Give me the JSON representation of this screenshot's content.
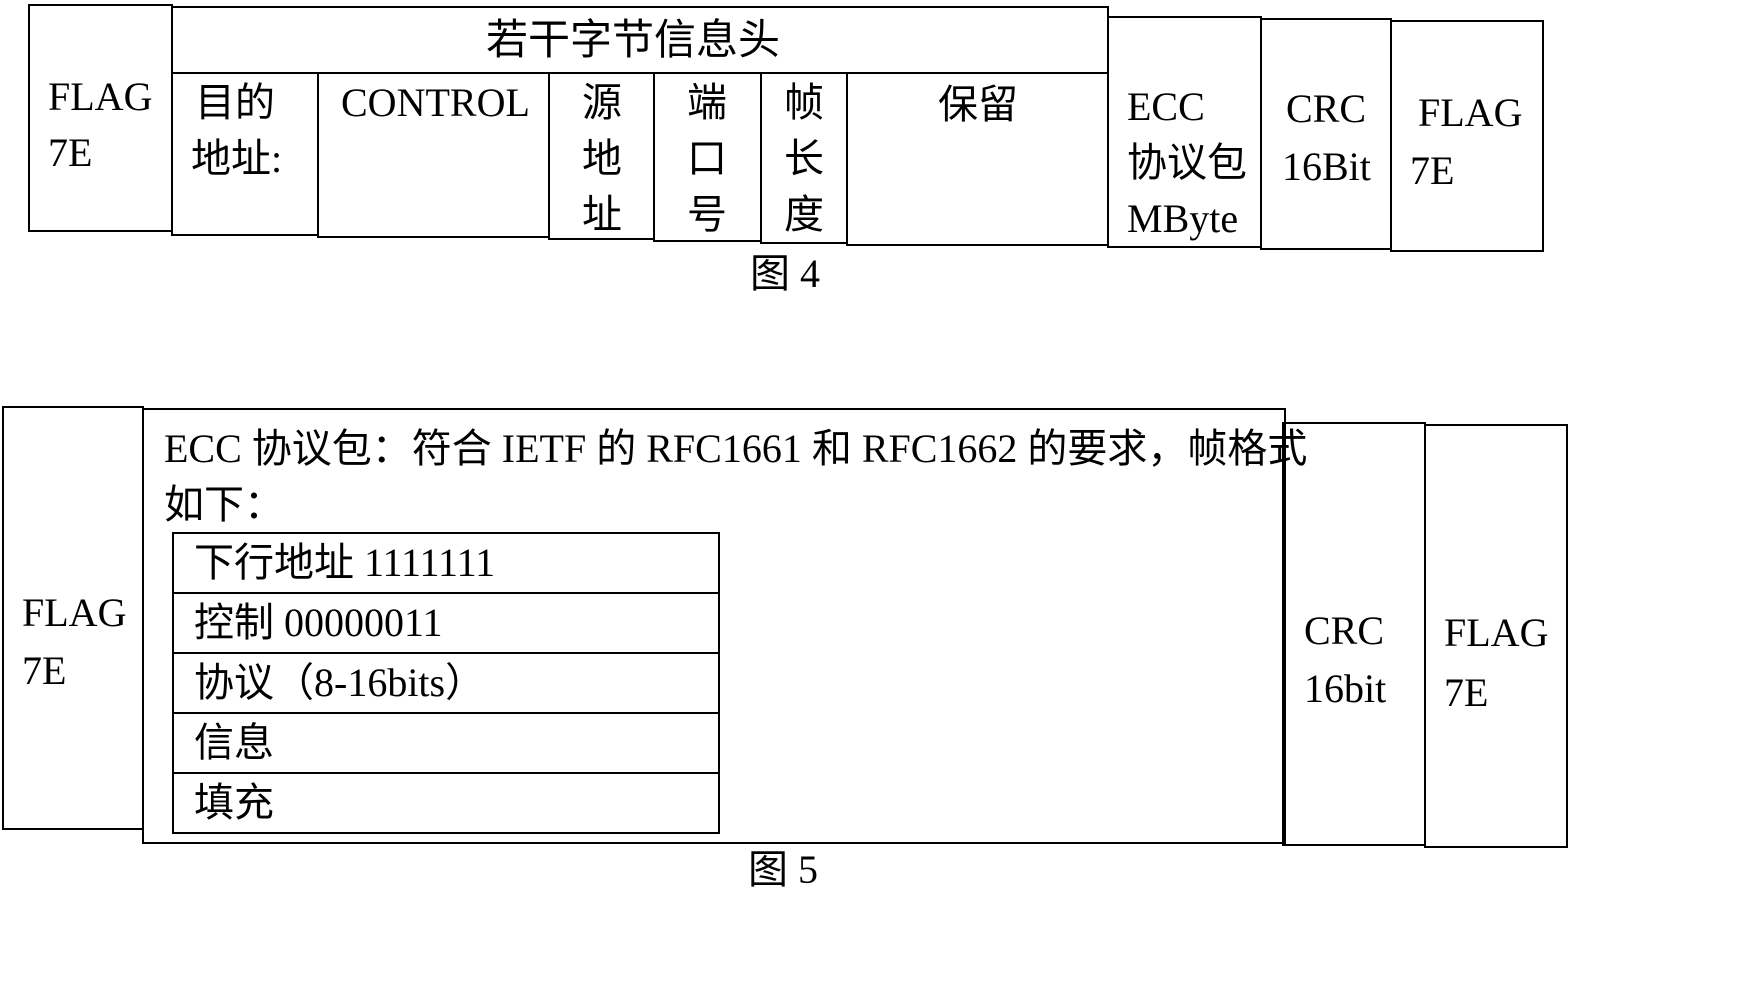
{
  "figure4": {
    "caption": "图 4",
    "flag_left": {
      "line1": "FLAG",
      "line2": "7E"
    },
    "header_title": "若干字节信息头",
    "fields": [
      {
        "line1": "目的",
        "line2": "地址:"
      },
      {
        "line1": "CONTROL"
      },
      {
        "chars": [
          "源",
          "地",
          "址"
        ]
      },
      {
        "chars": [
          "端",
          "口",
          "号"
        ]
      },
      {
        "chars": [
          "帧",
          "长",
          "度"
        ]
      },
      {
        "line1": "保留"
      }
    ],
    "ecc": {
      "line1": "ECC",
      "line2": "协议包",
      "line3": "MByte"
    },
    "crc": {
      "line1": "CRC",
      "line2": "16Bit"
    },
    "flag_right": {
      "line1": "FLAG",
      "line2": "7E"
    }
  },
  "figure5": {
    "caption": "图 5",
    "flag_left": {
      "line1": "FLAG",
      "line2": "7E"
    },
    "ecc_description": {
      "line1": "ECC 协议包：符合 IETF 的 RFC1661 和 RFC1662 的要求，帧格式",
      "line2": "如下："
    },
    "sub_rows": [
      "下行地址 1111111",
      "控制 00000011",
      "协议（8-16bits）",
      "信息",
      "填充"
    ],
    "crc": {
      "line1": "CRC",
      "line2": "16bit"
    },
    "flag_right": {
      "line1": "FLAG",
      "line2": "7E"
    }
  }
}
